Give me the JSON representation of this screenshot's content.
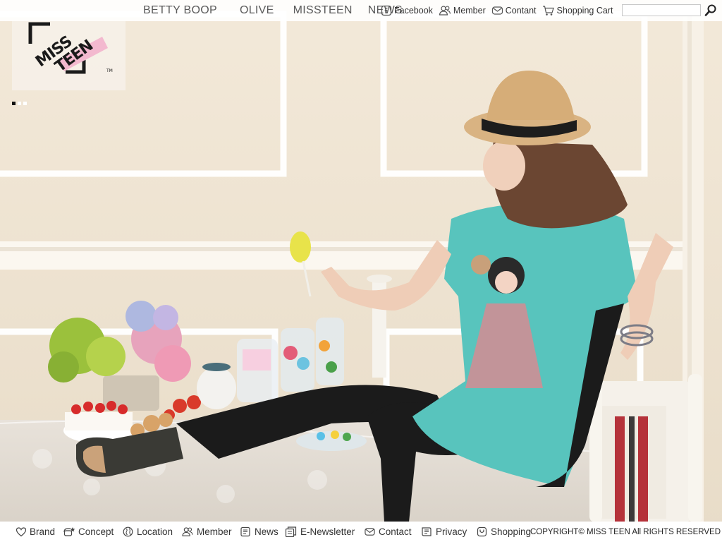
{
  "brand": {
    "logo_line1": "MISS",
    "logo_line2": "TEEN",
    "trademark": "TM"
  },
  "nav_main": [
    {
      "label": "BETTY BOOP"
    },
    {
      "label": "OLIVE"
    },
    {
      "label": "MISSTEEN"
    },
    {
      "label": "NEWS"
    }
  ],
  "nav_secondary": [
    {
      "label": "Facebook",
      "icon": "facebook-icon"
    },
    {
      "label": "Member",
      "icon": "member-icon"
    },
    {
      "label": "Contant",
      "icon": "mail-icon"
    },
    {
      "label": "Shopping Cart",
      "icon": "cart-icon"
    }
  ],
  "search": {
    "value": "",
    "placeholder": "",
    "icon": "search-icon"
  },
  "slider": {
    "total": 3,
    "active_index": 0
  },
  "footer": {
    "links": [
      {
        "label": "Brand",
        "icon": "heart-icon"
      },
      {
        "label": "Concept",
        "icon": "star-icon"
      },
      {
        "label": "Location",
        "icon": "globe-icon"
      },
      {
        "label": "Member",
        "icon": "member-icon"
      },
      {
        "label": "News",
        "icon": "news-icon"
      },
      {
        "label": "E-Newsletter",
        "icon": "newsletter-icon"
      },
      {
        "label": "Contact",
        "icon": "mail-icon"
      },
      {
        "label": "Privacy",
        "icon": "document-icon"
      },
      {
        "label": "Shopping",
        "icon": "bag-icon"
      }
    ],
    "copyright": "COPYRIGHT© MISS TEEN All RIGHTS RESERVED"
  },
  "colors": {
    "wall": "#efe4d2",
    "molding": "#ffffff",
    "shirt": "#58c4bd",
    "logo_pink": "#f3b9cf",
    "text_dark": "#333333"
  }
}
